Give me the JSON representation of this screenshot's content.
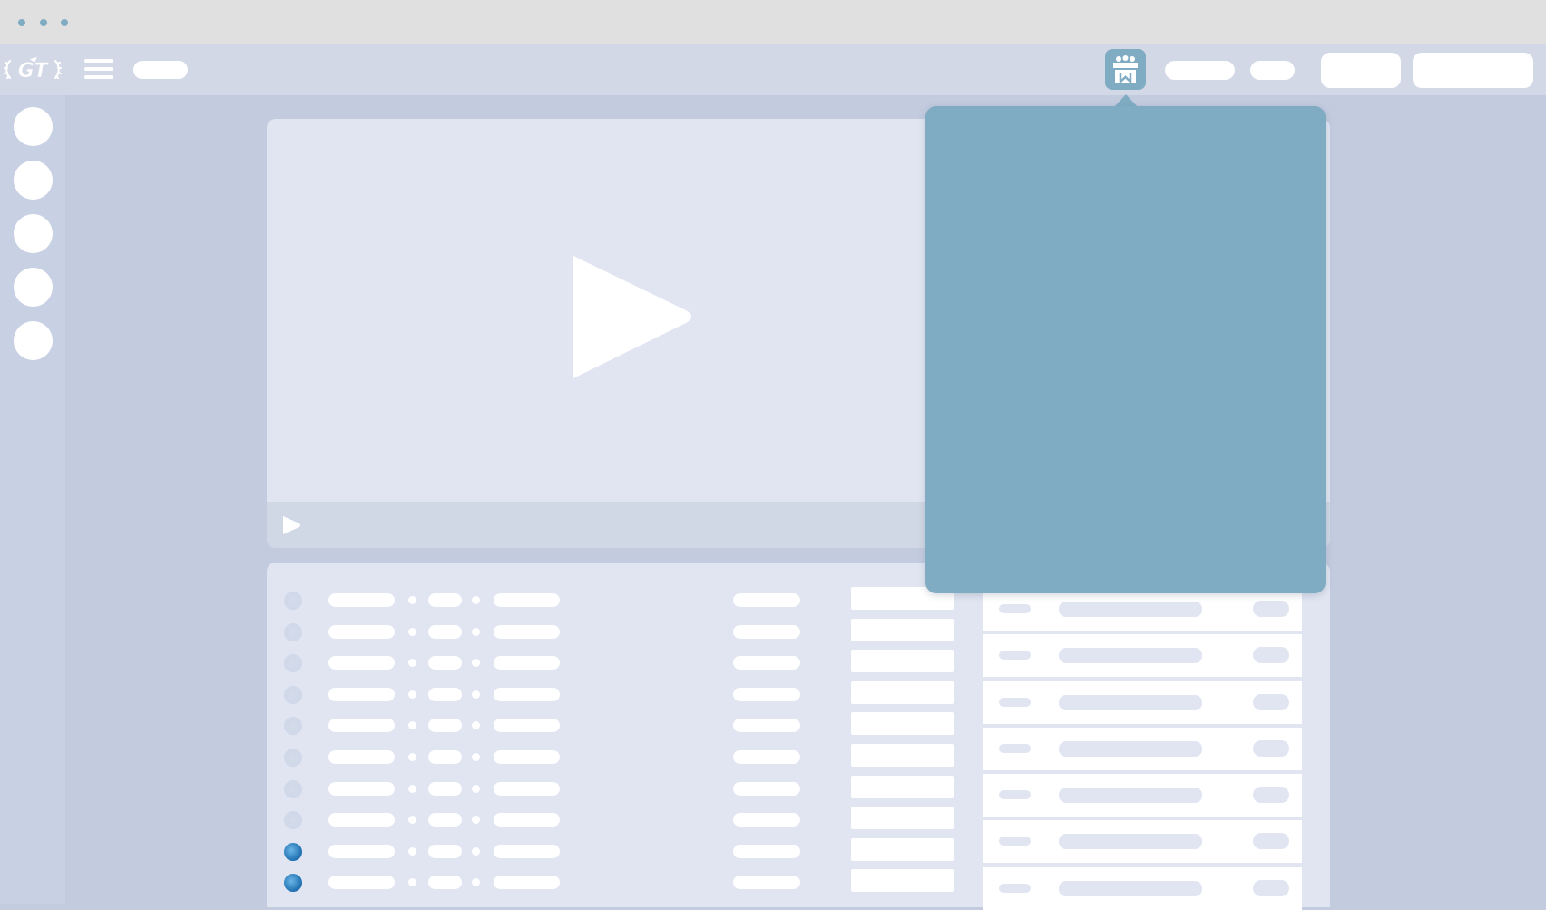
{
  "window": {
    "title_dots": [
      "dot",
      "dot",
      "dot"
    ],
    "accent_color": "#80acc3"
  },
  "header": {
    "logo_text": "GT",
    "menu_icon": "hamburger-icon",
    "gift_icon": "gift-icon"
  },
  "sidebar": {
    "items": [
      {
        "icon": "circle-icon"
      },
      {
        "icon": "circle-icon"
      },
      {
        "icon": "circle-icon"
      },
      {
        "icon": "circle-icon"
      },
      {
        "icon": "circle-icon"
      }
    ]
  },
  "player": {
    "play_icon": "play-icon",
    "control_play_icon": "play-icon"
  },
  "list": {
    "rows": [
      {
        "status": "inactive"
      },
      {
        "status": "inactive"
      },
      {
        "status": "inactive"
      },
      {
        "status": "inactive"
      },
      {
        "status": "inactive"
      },
      {
        "status": "inactive"
      },
      {
        "status": "inactive"
      },
      {
        "status": "inactive"
      },
      {
        "status": "active"
      },
      {
        "status": "active"
      }
    ],
    "cards_count_visible": 7
  },
  "popover": {
    "color": "#80acc3"
  }
}
